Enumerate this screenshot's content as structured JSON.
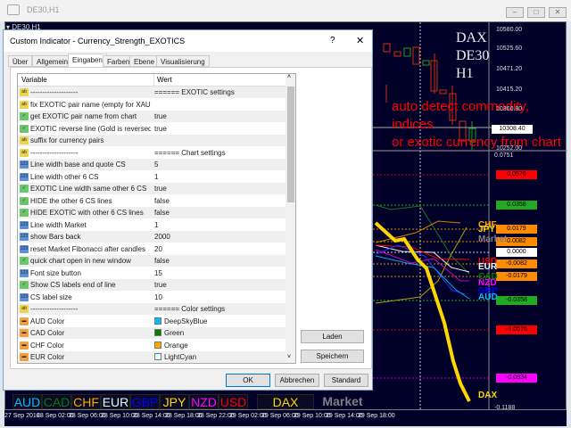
{
  "window": {
    "title": "DE30,H1",
    "chart_tab": "DE30,H1"
  },
  "chart": {
    "overlay_lines": [
      "DAX",
      "DE30",
      "H1"
    ],
    "annotation": [
      "auto detect commodity, indices",
      "or exotic currency from chart"
    ],
    "price_axis": [
      "10580.00",
      "10525.60",
      "10471.20",
      "10415.20",
      "10360.80",
      "10308.40",
      "10252.00"
    ],
    "indicator_axis": [
      {
        "v": "0.0751",
        "bg": ""
      },
      {
        "v": "0.0576",
        "bg": "#ff0000"
      },
      {
        "v": "0.0358",
        "bg": "#22aa22"
      },
      {
        "v": "0.0179",
        "bg": "#ff8c00"
      },
      {
        "v": "0.0082",
        "bg": "#ff8c00"
      },
      {
        "v": "0.0000",
        "bg": "#ffffff"
      },
      {
        "v": "-0.0082",
        "bg": "#ff8c00"
      },
      {
        "v": "-0.0179",
        "bg": "#ff8c00"
      },
      {
        "v": "-0.0358",
        "bg": "#22aa22"
      },
      {
        "v": "-0.0576",
        "bg": "#ff0000"
      },
      {
        "v": "-0.0934",
        "bg": "#ff00ff"
      },
      {
        "v": "-0.1188",
        "bg": ""
      }
    ],
    "line_labels": [
      {
        "t": "CHF",
        "c": "#ffa500"
      },
      {
        "t": "JPY",
        "c": "#ffd700"
      },
      {
        "t": "Market",
        "c": "#808080"
      },
      {
        "t": "USD",
        "c": "#ff0000"
      },
      {
        "t": "EUR",
        "c": "#ffffff"
      },
      {
        "t": "CAD",
        "c": "#008000"
      },
      {
        "t": "NZD",
        "c": "#ff00ff"
      },
      {
        "t": "GBP",
        "c": "#0000ff"
      },
      {
        "t": "AUD",
        "c": "#00bfff"
      },
      {
        "t": "DAX",
        "c": "#ffd700"
      }
    ],
    "time_axis": [
      "27 Sep 2016",
      "28 Sep 02:00",
      "28 Sep 06:00",
      "28 Sep 10:00",
      "28 Sep 14:00",
      "28 Sep 18:00",
      "28 Sep 22:00",
      "29 Sep 02:00",
      "29 Sep 06:00",
      "29 Sep 10:00",
      "29 Sep 14:00",
      "29 Sep 18:00"
    ],
    "currency_buttons": [
      {
        "t": "AUD",
        "c": "#00bfff"
      },
      {
        "t": "CAD",
        "c": "#008000"
      },
      {
        "t": "CHF",
        "c": "#ffa500"
      },
      {
        "t": "EUR",
        "c": "#e0ffff"
      },
      {
        "t": "GBP",
        "c": "#0000ff"
      },
      {
        "t": "JPY",
        "c": "#ffd700"
      },
      {
        "t": "NZD",
        "c": "#ff00ff"
      },
      {
        "t": "USD",
        "c": "#ff0000"
      }
    ],
    "exotic_button": "DAX",
    "market_button": "Market"
  },
  "dialog": {
    "title": "Custom Indicator - Currency_Strength_EXOTICS",
    "help": "?",
    "close": "✕",
    "tabs": [
      "Über",
      "Allgemein",
      "Eingaben",
      "Farben",
      "Ebene",
      "Visualisierung"
    ],
    "active_tab": "Eingaben",
    "columns": [
      "Variable",
      "Wert"
    ],
    "rows": [
      {
        "type": "ab",
        "name": "--------------------",
        "value": "====== EXOTIC settings"
      },
      {
        "type": "ab",
        "name": "fix EXOTIC pair name (empty for XAUU...",
        "value": ""
      },
      {
        "type": "bool",
        "name": "get EXOTIC pair name from chart",
        "value": "true"
      },
      {
        "type": "bool",
        "name": "EXOTIC reverse line (Gold is reversed)",
        "value": "true"
      },
      {
        "type": "ab",
        "name": "suffix for currency pairs",
        "value": ""
      },
      {
        "type": "ab",
        "name": "--------------------",
        "value": "====== Chart settings"
      },
      {
        "type": "int",
        "name": "Line width base and quote CS",
        "value": "5"
      },
      {
        "type": "int",
        "name": "Line width other 6 CS",
        "value": "1"
      },
      {
        "type": "bool",
        "name": "EXOTIC Line width same other 6 CS",
        "value": "true"
      },
      {
        "type": "bool",
        "name": "HIDE the other 6 CS lines",
        "value": "false"
      },
      {
        "type": "bool",
        "name": "HIDE EXOTIC with other 6 CS lines",
        "value": "false"
      },
      {
        "type": "int",
        "name": "Line width Market",
        "value": "1"
      },
      {
        "type": "int",
        "name": "show Bars back",
        "value": "2000"
      },
      {
        "type": "int",
        "name": "reset Market Fibonacci after candles",
        "value": "20"
      },
      {
        "type": "bool",
        "name": "quick chart open in new window",
        "value": "false"
      },
      {
        "type": "int",
        "name": "Font size button",
        "value": "15"
      },
      {
        "type": "bool",
        "name": "Show CS labels end of line",
        "value": "true"
      },
      {
        "type": "int",
        "name": "CS label size",
        "value": "10"
      },
      {
        "type": "ab",
        "name": "--------------------",
        "value": "====== Color settings"
      },
      {
        "type": "color",
        "name": "AUD Color",
        "value": "DeepSkyBlue",
        "swatch": "#00bfff"
      },
      {
        "type": "color",
        "name": "CAD Color",
        "value": "Green",
        "swatch": "#008000"
      },
      {
        "type": "color",
        "name": "CHF Color",
        "value": "Orange",
        "swatch": "#ffa500"
      },
      {
        "type": "color",
        "name": "EUR Color",
        "value": "LightCyan",
        "swatch": "#e0ffff"
      }
    ],
    "buttons": {
      "load": "Laden",
      "save": "Speichern",
      "ok": "OK",
      "cancel": "Abbrechen",
      "default": "Standard"
    }
  }
}
